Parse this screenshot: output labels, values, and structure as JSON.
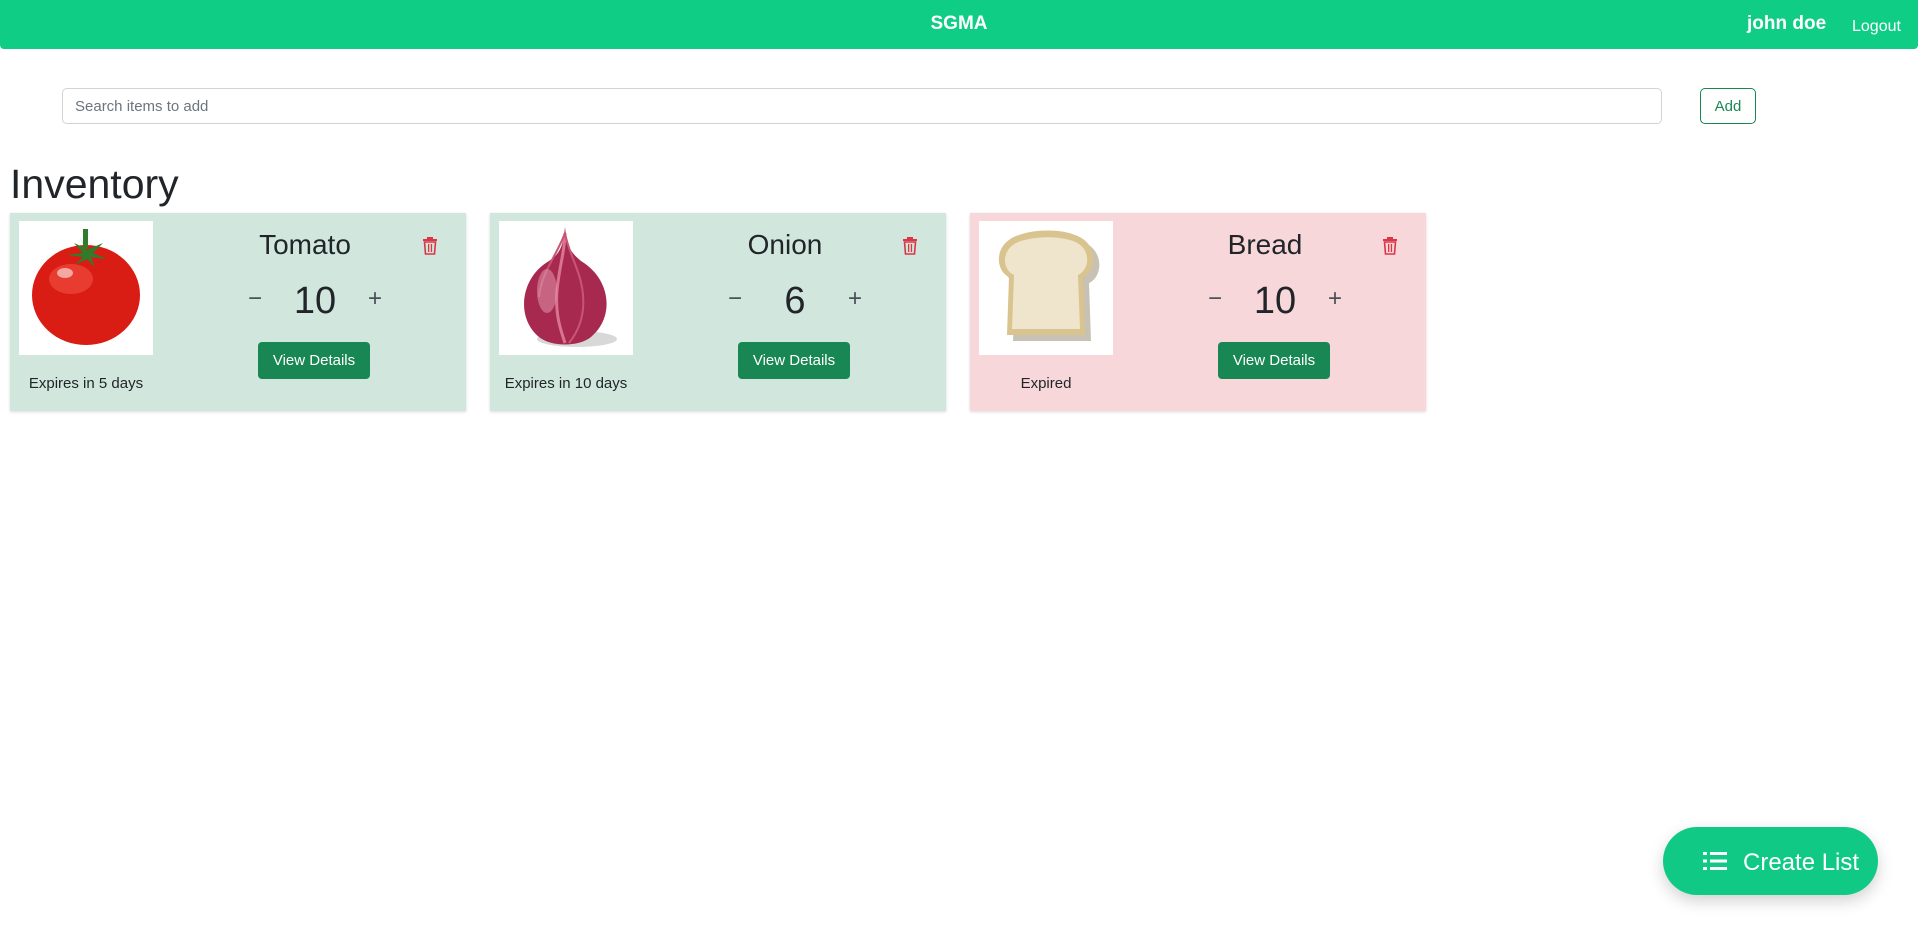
{
  "header": {
    "brand": "SGMA",
    "user_name": "john doe",
    "logout_label": "Logout",
    "background": "#0fcd85"
  },
  "search": {
    "placeholder": "Search items to add",
    "value": "",
    "add_label": "Add"
  },
  "page_title": "Inventory",
  "items": [
    {
      "name": "Tomato",
      "quantity": "10",
      "expiry": "Expires in 5 days",
      "status": "fresh",
      "image_icon": "tomato-image",
      "details_label": "View Details",
      "minus_label": "−",
      "plus_label": "+"
    },
    {
      "name": "Onion",
      "quantity": "6",
      "expiry": "Expires in 10 days",
      "status": "fresh",
      "image_icon": "onion-image",
      "details_label": "View Details",
      "minus_label": "−",
      "plus_label": "+"
    },
    {
      "name": "Bread",
      "quantity": "10",
      "expiry": "Expired",
      "status": "expired",
      "image_icon": "bread-image",
      "details_label": "View Details",
      "minus_label": "−",
      "plus_label": "+"
    }
  ],
  "fab": {
    "label": "Create List",
    "icon": "list-icon"
  },
  "colors": {
    "fresh_card": "#d1e7dd",
    "expired_card": "#f8d7da",
    "primary_button": "#198754",
    "danger_icon": "#dc3545"
  }
}
